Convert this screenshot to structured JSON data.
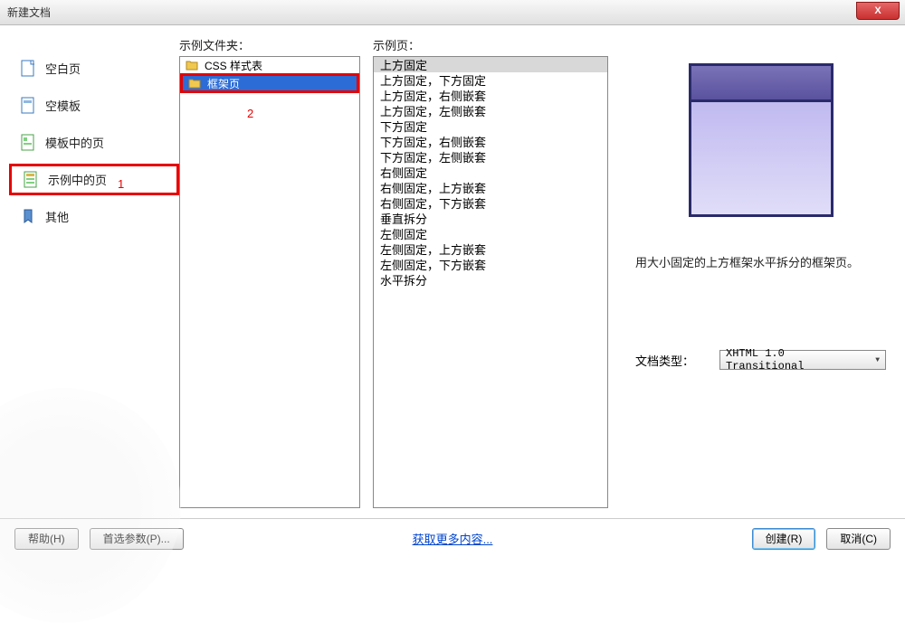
{
  "window": {
    "title": "新建文档",
    "close": "X"
  },
  "categories": {
    "items": [
      {
        "label": "空白页"
      },
      {
        "label": "空模板"
      },
      {
        "label": "模板中的页"
      },
      {
        "label": "示例中的页"
      },
      {
        "label": "其他"
      }
    ]
  },
  "annotations": {
    "one": "1",
    "two": "2"
  },
  "folders": {
    "header": "示例文件夹：",
    "items": [
      {
        "label": "CSS 样式表"
      },
      {
        "label": "框架页"
      }
    ]
  },
  "pages": {
    "header": "示例页：",
    "items": [
      "上方固定",
      "上方固定，下方固定",
      "上方固定，右侧嵌套",
      "上方固定，左侧嵌套",
      "下方固定",
      "下方固定，右侧嵌套",
      "下方固定，左侧嵌套",
      "右侧固定",
      "右侧固定，上方嵌套",
      "右侧固定，下方嵌套",
      "垂直拆分",
      "左侧固定",
      "左侧固定，上方嵌套",
      "左侧固定，下方嵌套",
      "水平拆分"
    ]
  },
  "preview": {
    "description": "用大小固定的上方框架水平拆分的框架页。"
  },
  "doctype": {
    "label": "文档类型：",
    "value": "XHTML 1.0 Transitional"
  },
  "footer": {
    "help": "帮助(H)",
    "prefs": "首选参数(P)...",
    "more_link": "获取更多内容...",
    "create": "创建(R)",
    "cancel": "取消(C)"
  }
}
